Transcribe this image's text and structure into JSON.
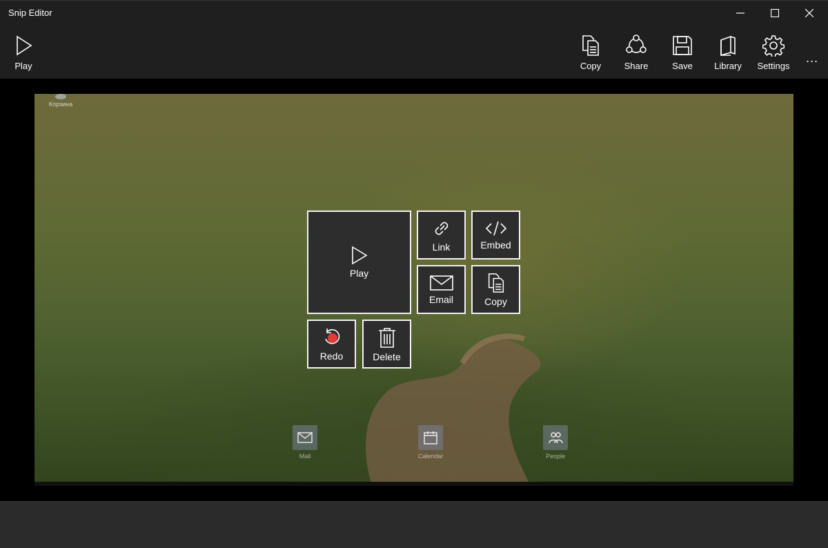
{
  "window": {
    "title": "Snip Editor"
  },
  "toolbar": {
    "play_label": "Play",
    "copy_label": "Copy",
    "share_label": "Share",
    "save_label": "Save",
    "library_label": "Library",
    "settings_label": "Settings",
    "more_label": "..."
  },
  "desktop": {
    "recycle_label": "Корзина",
    "icons": [
      {
        "name": "Mail",
        "icon": "mail-icon"
      },
      {
        "name": "Calendar",
        "icon": "calendar-icon"
      },
      {
        "name": "People",
        "icon": "people-icon"
      }
    ]
  },
  "menu": {
    "play_label": "Play",
    "link_label": "Link",
    "embed_label": "Embed",
    "email_label": "Email",
    "copy_label": "Copy",
    "redo_label": "Redo",
    "delete_label": "Delete"
  },
  "colors": {
    "record_dot": "#e53935",
    "tile_border": "#f2f2f2",
    "tile_bg": "#2d2d2d"
  }
}
